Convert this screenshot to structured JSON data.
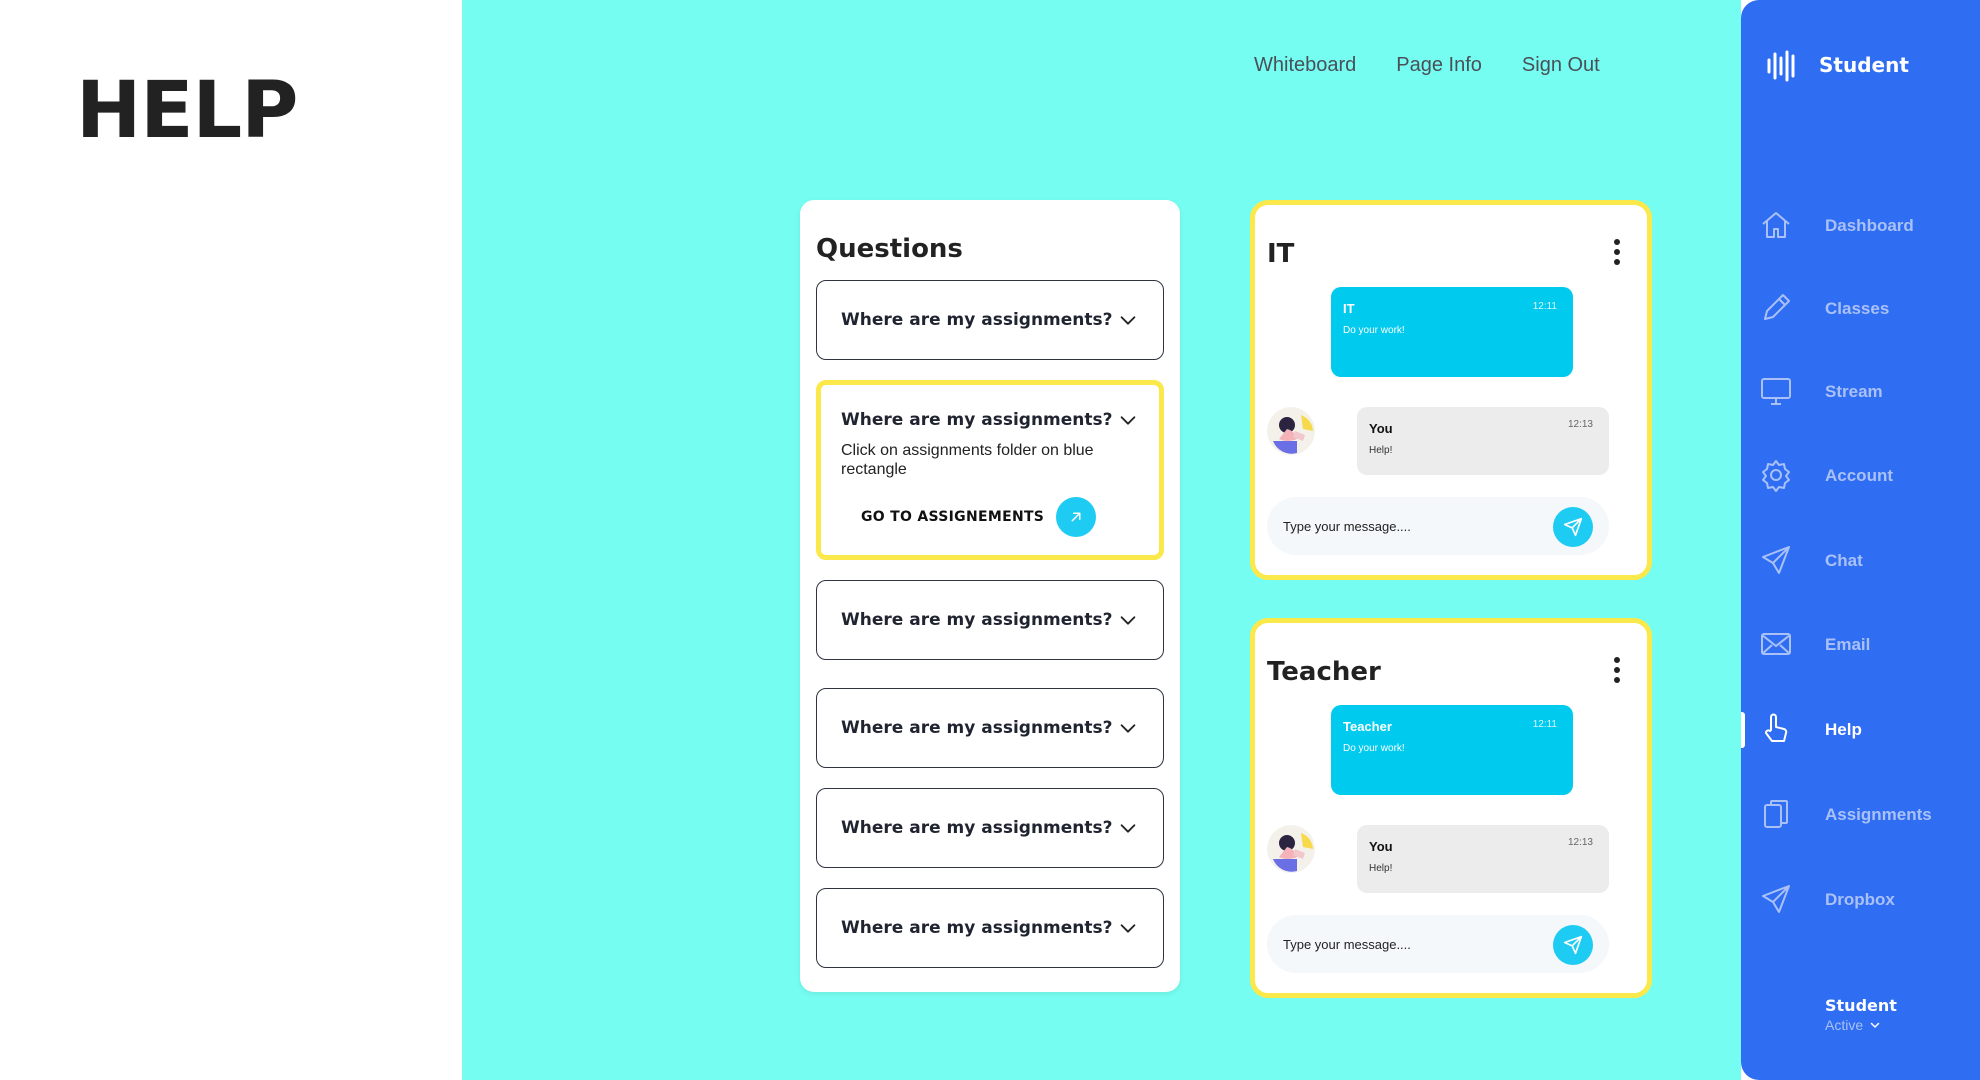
{
  "page": {
    "heading": "HELP"
  },
  "topnav": {
    "items": [
      "Whiteboard",
      "Page Info",
      "Sign Out"
    ]
  },
  "questions": {
    "title": "Questions",
    "items": [
      {
        "question": "Where are my assignments?"
      },
      {
        "question": "Where are my assignments?",
        "answer": "Click on assignments folder on blue rectangle",
        "action_label": "GO TO ASSIGNEMENTS"
      },
      {
        "question": "Where are my assignments?"
      },
      {
        "question": "Where are my assignments?"
      },
      {
        "question": "Where are my assignments?"
      },
      {
        "question": "Where are my assignments?"
      }
    ]
  },
  "chats": [
    {
      "title": "IT",
      "incoming": {
        "name": "IT",
        "time": "12:11",
        "text": "Do your work!"
      },
      "outgoing": {
        "name": "You",
        "time": "12:13",
        "text": "Help!"
      },
      "input_placeholder": "Type your message...."
    },
    {
      "title": "Teacher",
      "incoming": {
        "name": "Teacher",
        "time": "12:11",
        "text": "Do your work!"
      },
      "outgoing": {
        "name": "You",
        "time": "12:13",
        "text": "Help!"
      },
      "input_placeholder": "Type your message...."
    }
  ],
  "sidebar": {
    "brand": "Student",
    "items": [
      {
        "label": "Dashboard",
        "icon": "home-icon"
      },
      {
        "label": "Classes",
        "icon": "pencil-icon"
      },
      {
        "label": "Stream",
        "icon": "monitor-icon"
      },
      {
        "label": "Account",
        "icon": "gear-icon"
      },
      {
        "label": "Chat",
        "icon": "paper-plane-icon"
      },
      {
        "label": "Email",
        "icon": "envelope-icon"
      },
      {
        "label": "Help",
        "icon": "pointing-hand-icon",
        "active": true
      },
      {
        "label": "Assignments",
        "icon": "documents-icon"
      },
      {
        "label": "Dropbox",
        "icon": "paper-plane-icon"
      }
    ],
    "user": {
      "name": "Student",
      "status": "Active"
    }
  },
  "colors": {
    "main_bg": "#76fdf1",
    "sidebar_bg": "#2f6df2",
    "accent_cyan": "#1ecbf2",
    "highlight_yellow": "#fbe84a"
  }
}
